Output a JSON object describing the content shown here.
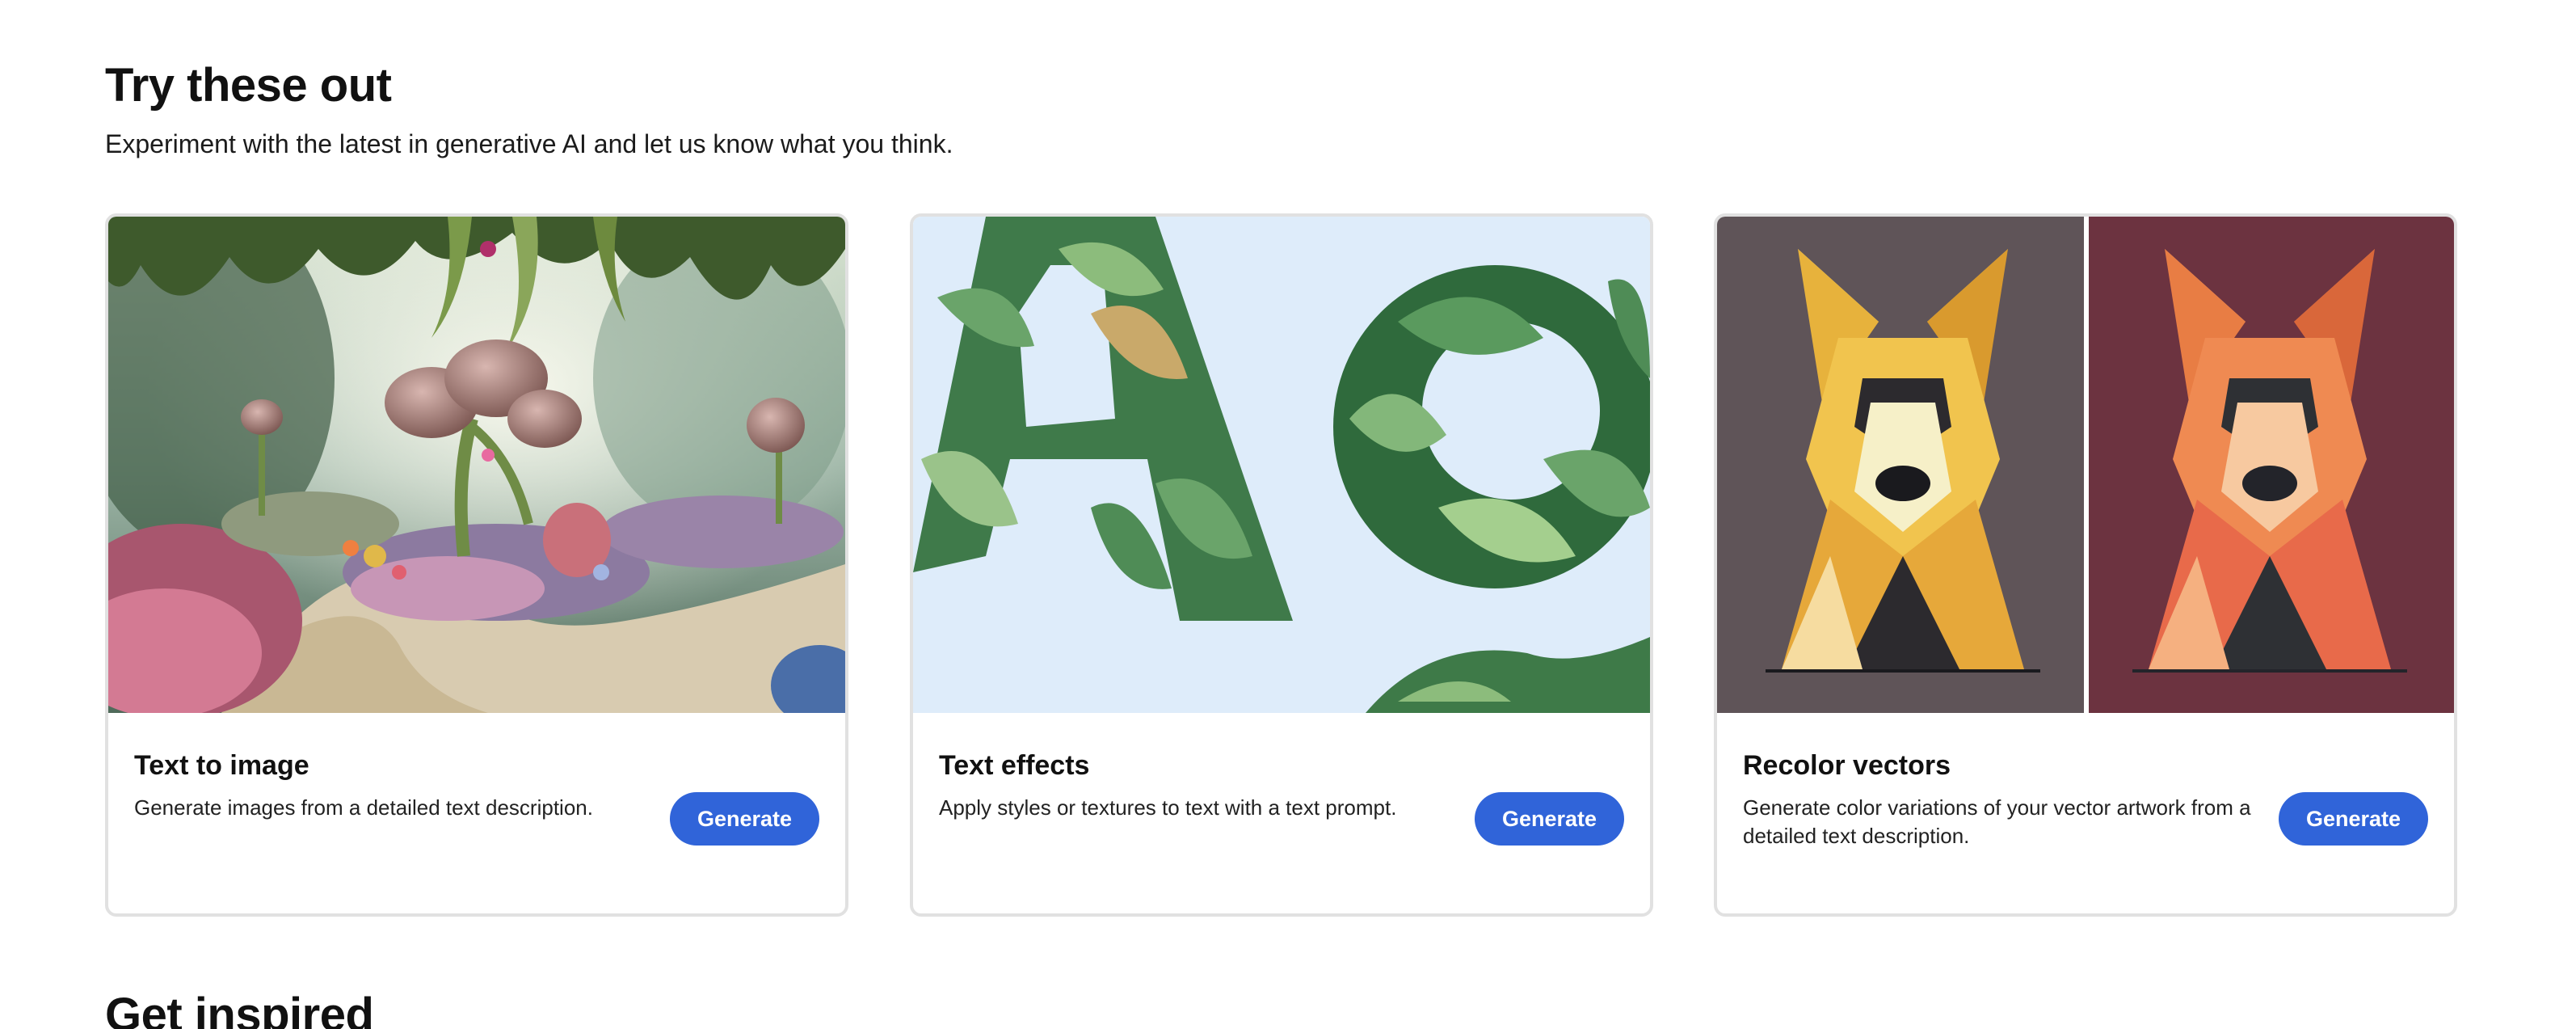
{
  "try_section": {
    "title": "Try these out",
    "subtitle": "Experiment with the latest in generative AI and let us know what you think."
  },
  "cards": [
    {
      "title": "Text to image",
      "description": "Generate images from a detailed text description.",
      "button_label": "Generate",
      "image": "fantasy-garden-illustration"
    },
    {
      "title": "Text effects",
      "description": "Apply styles or textures to text with a text prompt.",
      "button_label": "Generate",
      "image": "leafy-letters-illustration"
    },
    {
      "title": "Recolor vectors",
      "description": "Generate color variations of your vector artwork from a detailed text description.",
      "button_label": "Generate",
      "image": "geometric-dog-recolor-illustration"
    }
  ],
  "inspired_section": {
    "title": "Get inspired"
  },
  "colors": {
    "button_bg": "#3064d9",
    "button_text": "#ffffff",
    "card_border": "#e1e1e1"
  }
}
